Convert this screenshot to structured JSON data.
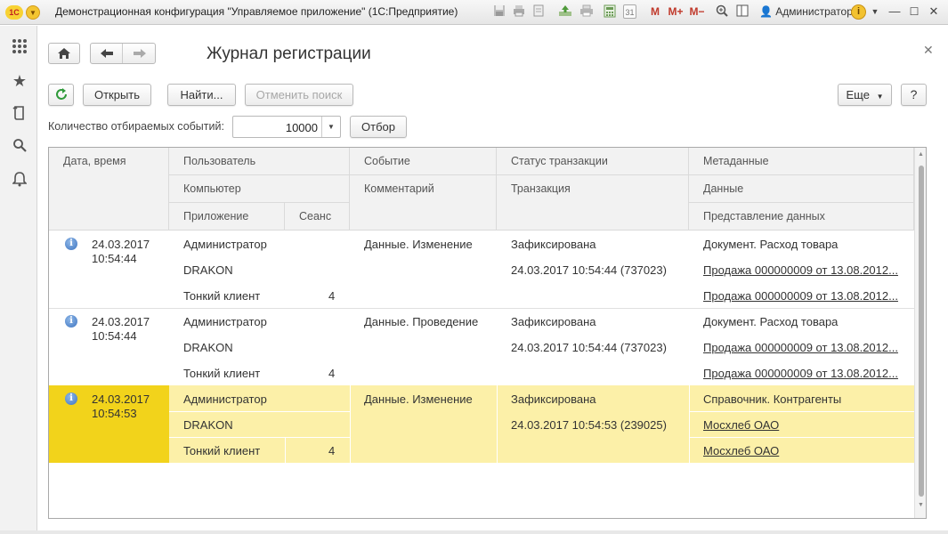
{
  "app": {
    "logo_text": "1С",
    "window_title": "Демонстрационная конфигурация \"Управляемое приложение\" (1С:Предприятие)",
    "user": "Администратор",
    "toolbar_icons": [
      "save-icon",
      "print-icon",
      "preview-icon",
      "upload-icon",
      "printer-icon",
      "calculator-icon",
      "calendar-icon",
      "memory-m-icon",
      "memory-m-plus-icon",
      "memory-m-minus-icon",
      "zoom-icon",
      "panels-icon"
    ],
    "memory_labels": {
      "m": "M",
      "m_plus": "M+",
      "m_minus": "M−"
    },
    "calendar_day": "31"
  },
  "sidebar": {
    "icons": [
      "apps-grid-icon",
      "favorites-star-icon",
      "history-icon",
      "search-icon",
      "notifications-bell-icon"
    ]
  },
  "form": {
    "title": "Журнал регистрации",
    "buttons": {
      "open": "Открыть",
      "find": "Найти...",
      "cancel_search": "Отменить поиск",
      "more": "Еще",
      "help": "?",
      "filter": "Отбор"
    },
    "events_count_label": "Количество отбираемых событий:",
    "events_count_value": "10000"
  },
  "table": {
    "headers": {
      "date_time": "Дата, время",
      "user": "Пользователь",
      "event": "Событие",
      "transaction_status": "Статус транзакции",
      "metadata": "Метаданные",
      "computer": "Компьютер",
      "comment": "Комментарий",
      "transaction": "Транзакция",
      "data": "Данные",
      "application": "Приложение",
      "session": "Сеанс",
      "data_presentation": "Представление данных"
    },
    "rows": [
      {
        "date": "24.03.2017",
        "time": "10:54:44",
        "user": "Администратор",
        "computer": "DRAKON",
        "application": "Тонкий клиент",
        "session": "4",
        "event": "Данные. Изменение",
        "status": "Зафиксирована",
        "transaction": "24.03.2017 10:54:44 (737023)",
        "metadata": "Документ. Расход товара",
        "data": "Продажа 000000009 от 13.08.2012...",
        "data_presentation": "Продажа 000000009 от 13.08.2012..."
      },
      {
        "date": "24.03.2017",
        "time": "10:54:44",
        "user": "Администратор",
        "computer": "DRAKON",
        "application": "Тонкий клиент",
        "session": "4",
        "event": "Данные. Проведение",
        "status": "Зафиксирована",
        "transaction": "24.03.2017 10:54:44 (737023)",
        "metadata": "Документ. Расход товара",
        "data": "Продажа 000000009 от 13.08.2012...",
        "data_presentation": "Продажа 000000009 от 13.08.2012..."
      },
      {
        "date": "24.03.2017",
        "time": "10:54:53",
        "user": "Администратор",
        "computer": "DRAKON",
        "application": "Тонкий клиент",
        "session": "4",
        "event": "Данные. Изменение",
        "status": "Зафиксирована",
        "transaction": "24.03.2017 10:54:53 (239025)",
        "metadata": "Справочник. Контрагенты",
        "data": "Мосхлеб ОАО",
        "data_presentation": "Мосхлеб ОАО",
        "selected": true
      }
    ]
  },
  "colors": {
    "selected_row": "#fcf0a8",
    "selected_date_cell": "#f2d31b",
    "header_bg": "#f2f2f2"
  }
}
